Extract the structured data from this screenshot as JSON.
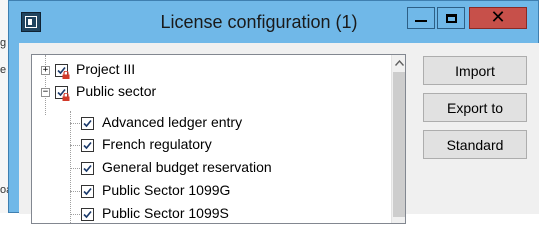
{
  "background": {
    "text_fragments": [
      "g",
      "e",
      "oa"
    ]
  },
  "window": {
    "title": "License configuration (1)",
    "buttons": {
      "minimize_icon": "minimize-icon",
      "maximize_icon": "maximize-icon",
      "close_glyph": "✕"
    }
  },
  "tree": {
    "nodes": [
      {
        "label": "Project III",
        "expander": "+",
        "checked": true,
        "locked": true,
        "level": 0
      },
      {
        "label": "Public sector",
        "expander": "−",
        "checked": true,
        "locked": true,
        "level": 0
      },
      {
        "label": "Advanced ledger entry",
        "checked": true,
        "locked": false,
        "level": 1
      },
      {
        "label": "French regulatory",
        "checked": true,
        "locked": false,
        "level": 1
      },
      {
        "label": "General budget reservation",
        "checked": true,
        "locked": false,
        "level": 1
      },
      {
        "label": "Public Sector 1099G",
        "checked": true,
        "locked": false,
        "level": 1
      },
      {
        "label": "Public Sector 1099S",
        "checked": true,
        "locked": false,
        "level": 1
      }
    ]
  },
  "actions": {
    "import": "Import",
    "export_to": "Export to",
    "standard": "Standard"
  },
  "colors": {
    "title_bar": "#70b8e8",
    "close_button": "#c7504a",
    "client_background": "#f0f0f0",
    "lock_icon": "#d23a2a"
  }
}
